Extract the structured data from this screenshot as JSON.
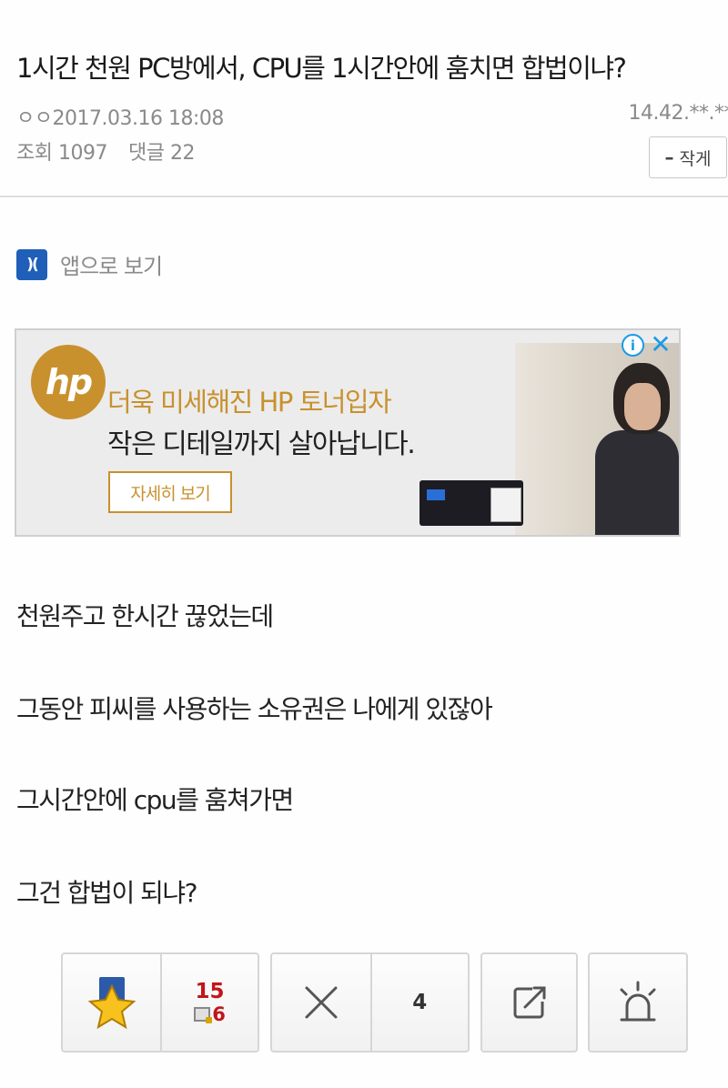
{
  "post": {
    "title": "1시간 천원 PC방에서, CPU를 1시간안에 훔치면 합법이냐?",
    "author": "ㅇㅇ",
    "date": "2017.03.16 18:08",
    "ip": "14.42.**.**",
    "views_label": "조회",
    "views": "1097",
    "comments_label": "댓글",
    "comments": "22",
    "font_size_button": "작게",
    "font_size_symbol": "–"
  },
  "app_link": {
    "icon_text": ")(",
    "label": "앱으로 보기",
    "icon_color": "#1f5fb8"
  },
  "ad": {
    "brand": "hp",
    "line1": "더욱 미세해진 HP 토너입자",
    "line2": "작은 디테일까지 살아납니다.",
    "cta": "자세히 보기",
    "info_symbol": "i",
    "close_symbol": "✕",
    "accent_color": "#c8912e"
  },
  "body": {
    "lines": [
      "천원주고 한시간 끊었는데",
      "그동안 피씨를 사용하는 소유권은 나에게 있잖아",
      "그시간안에 cpu를 훔쳐가면",
      "그건 합법이 되냐?"
    ]
  },
  "actions": {
    "favorite_icon": "star-icon",
    "favorite_count": "15",
    "favorite_sub_count": "6",
    "dislike_icon": "x-icon",
    "dislike_count": "4",
    "share_icon": "share-icon",
    "report_icon": "alarm-icon",
    "count_color": "#c0161a"
  }
}
